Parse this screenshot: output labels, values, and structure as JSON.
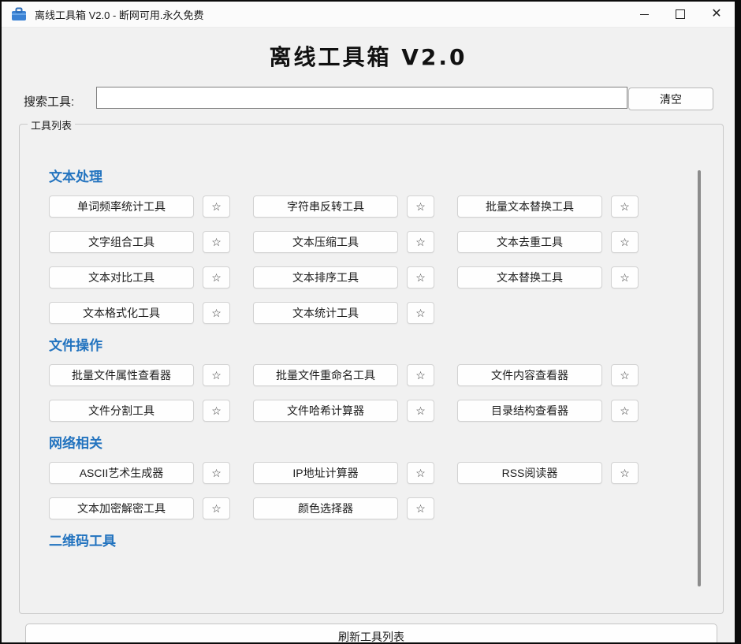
{
  "window": {
    "title": "离线工具箱 V2.0 - 断网可用.永久免费",
    "controls": {
      "minimize": "–",
      "maximize": "□",
      "close": "✕"
    }
  },
  "header": {
    "title": "离线工具箱 V2.0"
  },
  "search": {
    "label": "搜索工具:",
    "value": "",
    "clear_label": "清空"
  },
  "groupbox": {
    "label": "工具列表"
  },
  "sections": [
    {
      "title": "文本处理",
      "tools": [
        "单词频率统计工具",
        "字符串反转工具",
        "批量文本替换工具",
        "文字组合工具",
        "文本压缩工具",
        "文本去重工具",
        "文本对比工具",
        "文本排序工具",
        "文本替换工具",
        "文本格式化工具",
        "文本统计工具"
      ]
    },
    {
      "title": "文件操作",
      "tools": [
        "批量文件属性查看器",
        "批量文件重命名工具",
        "文件内容查看器",
        "文件分割工具",
        "文件哈希计算器",
        "目录结构查看器"
      ]
    },
    {
      "title": "网络相关",
      "tools": [
        "ASCII艺术生成器",
        "IP地址计算器",
        "RSS阅读器",
        "文本加密解密工具",
        "颜色选择器"
      ]
    },
    {
      "title": "二维码工具",
      "tools": []
    }
  ],
  "star_icon": "☆",
  "footer": {
    "refresh_label": "刷新工具列表"
  },
  "colors": {
    "accent_blue": "#2273bf",
    "window_bg": "#f1f1f1",
    "titlebar_bg": "#fbfbfb",
    "app_icon_blue": "#3b82d4"
  }
}
